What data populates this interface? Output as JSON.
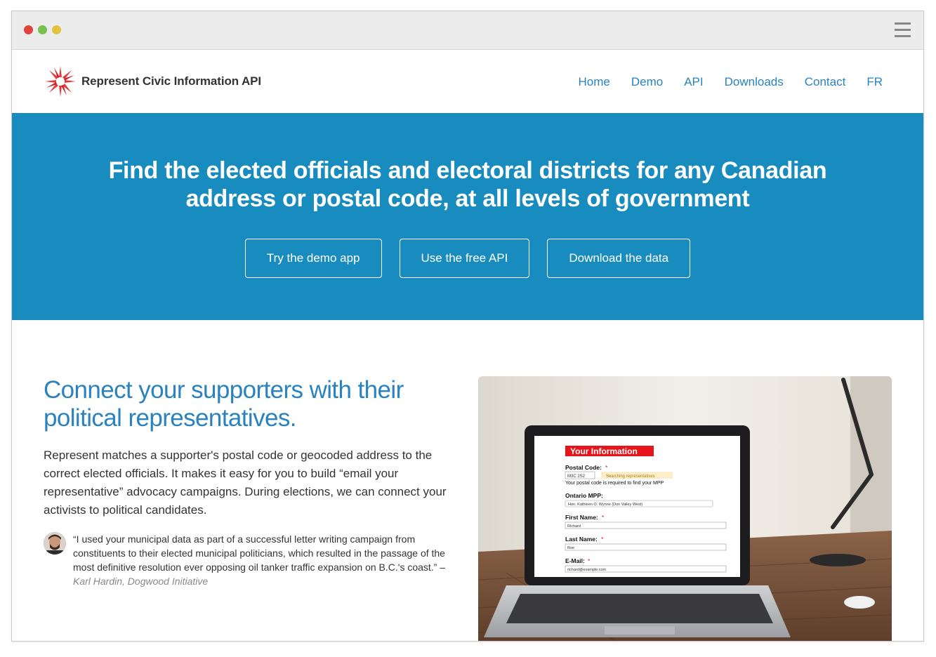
{
  "brand": {
    "name": "Represent Civic Information API"
  },
  "nav": [
    {
      "label": "Home"
    },
    {
      "label": "Demo"
    },
    {
      "label": "API"
    },
    {
      "label": "Downloads"
    },
    {
      "label": "Contact"
    },
    {
      "label": "FR"
    }
  ],
  "hero": {
    "title_line1": "Find the elected officials and electoral districts for any Canadian",
    "title_line2": "address or postal code, at all levels of government",
    "buttons": [
      {
        "label": "Try the demo app"
      },
      {
        "label": "Use the free API"
      },
      {
        "label": "Download the data"
      }
    ]
  },
  "section": {
    "heading": "Connect your supporters with their political representatives.",
    "body": "Represent matches a supporter's postal code or geocoded address to the correct elected officials. It makes it easy for you to build “email your representative” advocacy campaigns. During elections, we can connect your activists to political candidates.",
    "quote": "“I used your municipal data as part of a successful letter writing campaign from constituents to their elected municipal politicians, which resulted in the passage of the most definitive resolution ever opposing oil tanker traffic expansion on B.C.'s coast.” –",
    "quote_author": "Karl Hardin, Dogwood Initiative"
  },
  "laptop_form": {
    "title": "Your Information",
    "postal_label": "Postal Code:",
    "postal_value": "M3C 2S2",
    "searching": "Searching representatives",
    "postal_help": "Your postal code is required to find your MPP",
    "mpp_label": "Ontario MPP:",
    "mpp_value": "Hon. Kathleen O. Wynne (Don Valley West)",
    "first_label": "First Name:",
    "first_value": "Richard",
    "last_label": "Last Name:",
    "last_value": "Roe",
    "email_label": "E-Mail:",
    "email_value": "richard@example.com",
    "required_mark": "*"
  },
  "colors": {
    "hero_bg": "#188bbf",
    "link": "#2a82c0",
    "form_red": "#e8141c"
  }
}
